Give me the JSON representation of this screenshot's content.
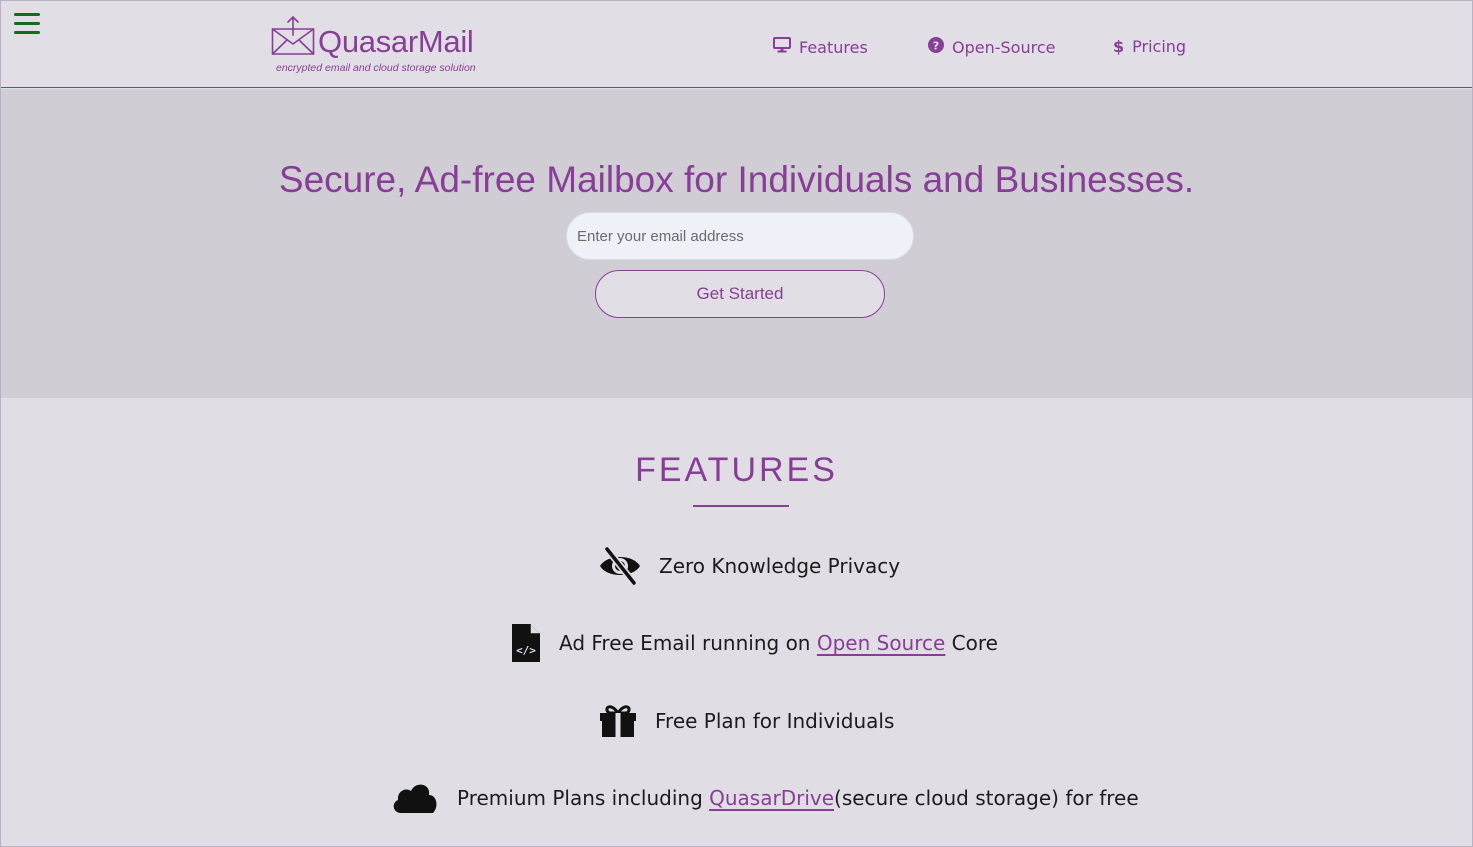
{
  "header": {
    "brand": "QuasarMail",
    "tagline": "encrypted email and cloud storage solution",
    "nav": [
      {
        "label": "Features",
        "icon": "monitor-icon"
      },
      {
        "label": "Open-Source",
        "icon": "question-circle-icon"
      },
      {
        "label": "Pricing",
        "icon": "dollar-icon"
      }
    ],
    "menu_icon": "hamburger-menu-icon"
  },
  "hero": {
    "headline": "Secure, Ad-free Mailbox for Individuals and Businesses.",
    "email_placeholder": "Enter your email address",
    "cta_label": "Get Started"
  },
  "features": {
    "title": "FEATURES",
    "items": [
      {
        "icon": "eye-slash-icon",
        "text": "Zero Knowledge Privacy"
      },
      {
        "icon": "file-code-icon",
        "text_before": "Ad Free Email running on ",
        "link": "Open Source",
        "text_after": " Core"
      },
      {
        "icon": "gift-icon",
        "text": "Free Plan for Individuals"
      },
      {
        "icon": "cloud-icon",
        "text_before": "Premium Plans including ",
        "link": "QuasarDrive",
        "text_after": "(secure cloud storage) for free"
      }
    ]
  },
  "colors": {
    "accent": "#883e97",
    "header_bg": "#e2dee5",
    "hero_bg": "#d0ced4",
    "menu_icon": "#116b1a"
  }
}
